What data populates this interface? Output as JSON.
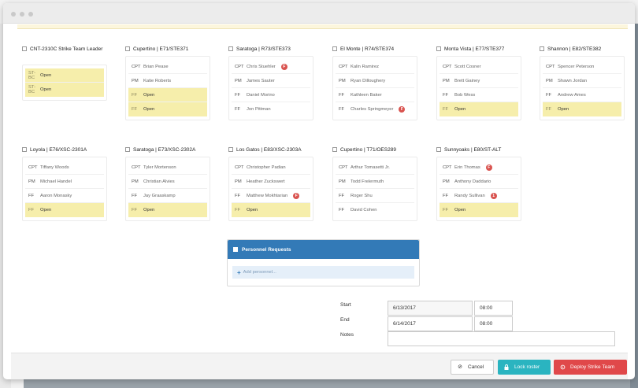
{
  "cards": [
    {
      "title": "CNT-2310C Strike Team Leader",
      "rows": [
        {
          "role": "ST-BC",
          "name": "Open",
          "open": true
        },
        {
          "role": "ST-BC",
          "name": "Open",
          "open": true
        }
      ]
    },
    {
      "title": "Cupertino | E71/STE371",
      "rows": [
        {
          "role": "CPT",
          "name": "Brian Pease",
          "open": false
        },
        {
          "role": "PM",
          "name": "Katie Roberts",
          "open": false
        },
        {
          "role": "FF",
          "name": "Open",
          "open": true
        },
        {
          "role": "FF",
          "name": "Open",
          "open": true
        }
      ]
    },
    {
      "title": "Saratoga | R73/STE373",
      "rows": [
        {
          "role": "CPT",
          "name": "Chris Stuehler",
          "open": false,
          "badge": "F"
        },
        {
          "role": "PM",
          "name": "James Sauter",
          "open": false
        },
        {
          "role": "FF",
          "name": "Daniel Morino",
          "open": false
        },
        {
          "role": "FF",
          "name": "Jon Pittman",
          "open": false
        }
      ]
    },
    {
      "title": "El Monte | R74/STE374",
      "rows": [
        {
          "role": "CPT",
          "name": "Kalin Ramirez",
          "open": false
        },
        {
          "role": "PM",
          "name": "Ryan Dilloughery",
          "open": false
        },
        {
          "role": "FF",
          "name": "Kathleen Baker",
          "open": false
        },
        {
          "role": "FF",
          "name": "Charles Springmeyer",
          "open": false,
          "badge": "F"
        }
      ]
    },
    {
      "title": "Monta Vista | E77/STE377",
      "rows": [
        {
          "role": "CPT",
          "name": "Scott Cosner",
          "open": false
        },
        {
          "role": "PM",
          "name": "Brett Gainey",
          "open": false
        },
        {
          "role": "FF",
          "name": "Bob Wess",
          "open": false
        },
        {
          "role": "FF",
          "name": "Open",
          "open": true
        }
      ]
    },
    {
      "title": "Shannon | E82/STE382",
      "rows": [
        {
          "role": "CPT",
          "name": "Spencer Peterson",
          "open": false
        },
        {
          "role": "PM",
          "name": "Shawn Jordan",
          "open": false
        },
        {
          "role": "FF",
          "name": "Andrew Ames",
          "open": false
        },
        {
          "role": "FF",
          "name": "Open",
          "open": true
        }
      ]
    },
    {
      "title": "Loyola | E76/XSC-2301A",
      "rows": [
        {
          "role": "CPT",
          "name": "Tiffany Woods",
          "open": false
        },
        {
          "role": "PM",
          "name": "Michael Handel",
          "open": false
        },
        {
          "role": "FF",
          "name": "Aaron Monasky",
          "open": false
        },
        {
          "role": "FF",
          "name": "Open",
          "open": true
        }
      ]
    },
    {
      "title": "Saratoga | E73/XSC-2302A",
      "rows": [
        {
          "role": "CPT",
          "name": "Tyler Mortenson",
          "open": false
        },
        {
          "role": "PM",
          "name": "Christian Alvies",
          "open": false
        },
        {
          "role": "FF",
          "name": "Jay Graaskamp",
          "open": false
        },
        {
          "role": "FF",
          "name": "Open",
          "open": true
        }
      ]
    },
    {
      "title": "Los Gatos | E83/XSC-2303A",
      "rows": [
        {
          "role": "CPT",
          "name": "Christopher Padian",
          "open": false
        },
        {
          "role": "PM",
          "name": "Heather Zuckswert",
          "open": false
        },
        {
          "role": "FF",
          "name": "Matthew Mokhtarian",
          "open": false,
          "badge": "F"
        },
        {
          "role": "FF",
          "name": "Open",
          "open": true
        }
      ]
    },
    {
      "title": "Cupertino | T71/OES289",
      "rows": [
        {
          "role": "CPT",
          "name": "Arthur Tomasetti Jr.",
          "open": false
        },
        {
          "role": "PM",
          "name": "Todd Frelermuth",
          "open": false
        },
        {
          "role": "FF",
          "name": "Roger Shu",
          "open": false
        },
        {
          "role": "FF",
          "name": "David Cohen",
          "open": false
        }
      ]
    },
    {
      "title": "Sunnyoaks | E80/ST-ALT",
      "rows": [
        {
          "role": "CPT",
          "name": "Erin Thomas",
          "open": false,
          "badge": "F"
        },
        {
          "role": "PM",
          "name": "Anthony Daddario",
          "open": false
        },
        {
          "role": "FF",
          "name": "Randy Sullivan",
          "open": false,
          "badge": "1"
        },
        {
          "role": "FF",
          "name": "Open",
          "open": true
        }
      ]
    }
  ],
  "personnel_requests": {
    "title": "Personnel Requests",
    "add_label": "Add personnel..."
  },
  "form": {
    "start_label": "Start",
    "start_date": "6/13/2017",
    "start_time": "08:00",
    "end_label": "End",
    "end_date": "6/14/2017",
    "end_time": "08:00",
    "notes_label": "Notes",
    "notes_value": ""
  },
  "footer": {
    "cancel_label": "Cancel",
    "lock_label": "Lock roster",
    "deploy_label": "Deploy Strike Team"
  },
  "colors": {
    "open_slot": "#f6eeab",
    "primary": "#337ab7",
    "lock": "#2ab4c0",
    "deploy": "#e0484a",
    "badge": "#d9534f"
  },
  "icons": {
    "cancel": "ban-icon",
    "lock": "lock-icon",
    "deploy": "crosshair-icon",
    "add": "plus-icon"
  }
}
